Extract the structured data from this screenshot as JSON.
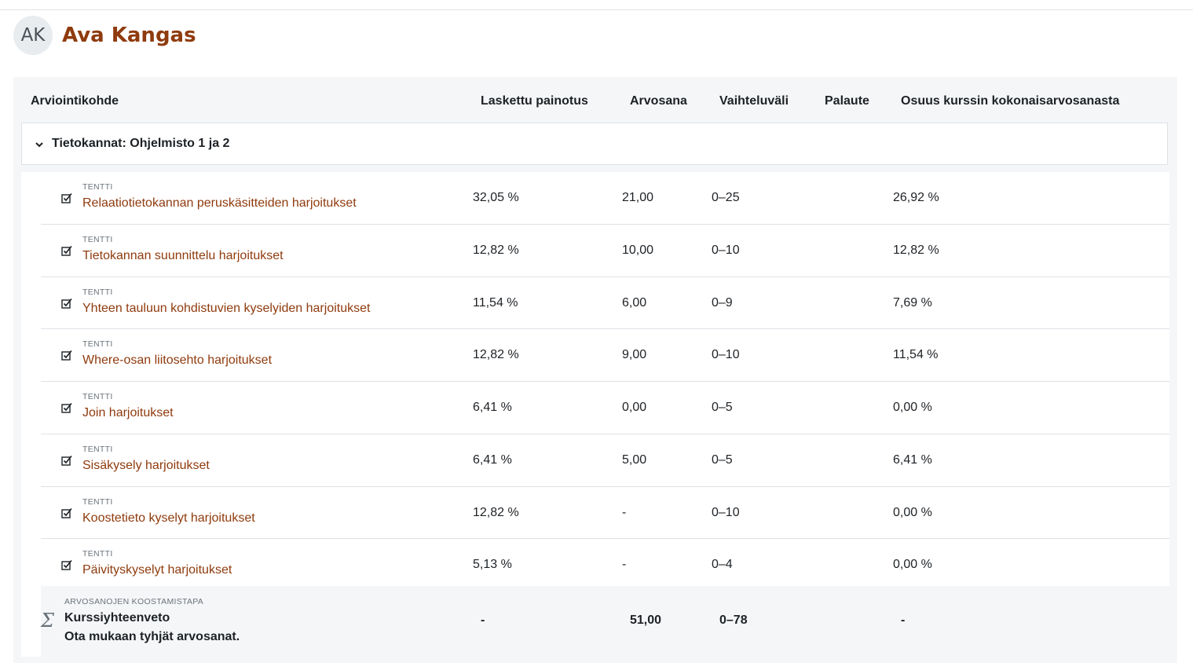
{
  "user": {
    "initials": "AK",
    "name": "Ava Kangas"
  },
  "columns": {
    "item": "Arviointikohde",
    "weight": "Laskettu painotus",
    "grade": "Arvosana",
    "range": "Vaihteluväli",
    "feedback": "Palaute",
    "contribution": "Osuus kurssin kokonaisarvosanasta"
  },
  "category": {
    "name": "Tietokannat: Ohjelmisto 1 ja 2",
    "chevron_icon": "chevron-down-icon"
  },
  "items": [
    {
      "type": "TENTTI",
      "name": "Relaatiotietokannan peruskäsitteiden harjoitukset",
      "weight": "32,05 %",
      "grade": "21,00",
      "range": "0–25",
      "contribution": "26,92 %"
    },
    {
      "type": "TENTTI",
      "name": "Tietokannan suunnittelu harjoitukset",
      "weight": "12,82 %",
      "grade": "10,00",
      "range": "0–10",
      "contribution": "12,82 %"
    },
    {
      "type": "TENTTI",
      "name": "Yhteen tauluun kohdistuvien kyselyiden harjoitukset",
      "weight": "11,54 %",
      "grade": "6,00",
      "range": "0–9",
      "contribution": "7,69 %"
    },
    {
      "type": "TENTTI",
      "name": "Where-osan liitosehto harjoitukset",
      "weight": "12,82 %",
      "grade": "9,00",
      "range": "0–10",
      "contribution": "11,54 %"
    },
    {
      "type": "TENTTI",
      "name": "Join harjoitukset",
      "weight": "6,41 %",
      "grade": "0,00",
      "range": "0–5",
      "contribution": "0,00 %"
    },
    {
      "type": "TENTTI",
      "name": "Sisäkysely harjoitukset",
      "weight": "6,41 %",
      "grade": "5,00",
      "range": "0–5",
      "contribution": "6,41 %"
    },
    {
      "type": "TENTTI",
      "name": "Koostetieto kyselyt harjoitukset",
      "weight": "12,82 %",
      "grade": "-",
      "range": "0–10",
      "contribution": "0,00 %"
    },
    {
      "type": "TENTTI",
      "name": "Päivityskyselyt harjoitukset",
      "weight": "5,13 %",
      "grade": "-",
      "range": "0–4",
      "contribution": "0,00 %"
    }
  ],
  "total": {
    "type": "ARVOSANOJEN KOOSTAMISTAPA",
    "name": "Kurssiyhteenveto",
    "note": "Ota mukaan tyhjät arvosanat.",
    "weight": "-",
    "grade": "51,00",
    "range": "0–78",
    "contribution": "-",
    "icon": "sigma-icon"
  },
  "colors": {
    "link": "#8f3b0e",
    "panel": "#f5f6f8",
    "border": "#dee2e6"
  }
}
